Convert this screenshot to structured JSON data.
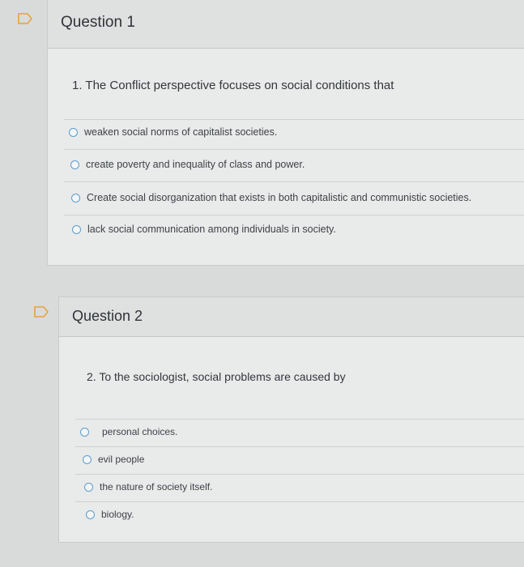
{
  "questions": [
    {
      "title": "Question 1",
      "prompt": "1. The Conflict perspective focuses on social conditions that",
      "options": [
        "weaken social norms of capitalist societies.",
        "create poverty and inequality of class and power.",
        "Create social disorganization that exists in both capitalistic and communistic societies.",
        "lack social communication among individuals in society."
      ]
    },
    {
      "title": "Question 2",
      "prompt": "2. To the sociologist, social problems are caused by",
      "options": [
        "personal choices.",
        "evil people",
        "the nature of society itself.",
        "biology."
      ]
    }
  ],
  "colors": {
    "flag": "#e8a23a",
    "radio": "#5b9fcf"
  },
  "icons": {
    "flag": "flag-icon",
    "radio": "radio-icon"
  }
}
